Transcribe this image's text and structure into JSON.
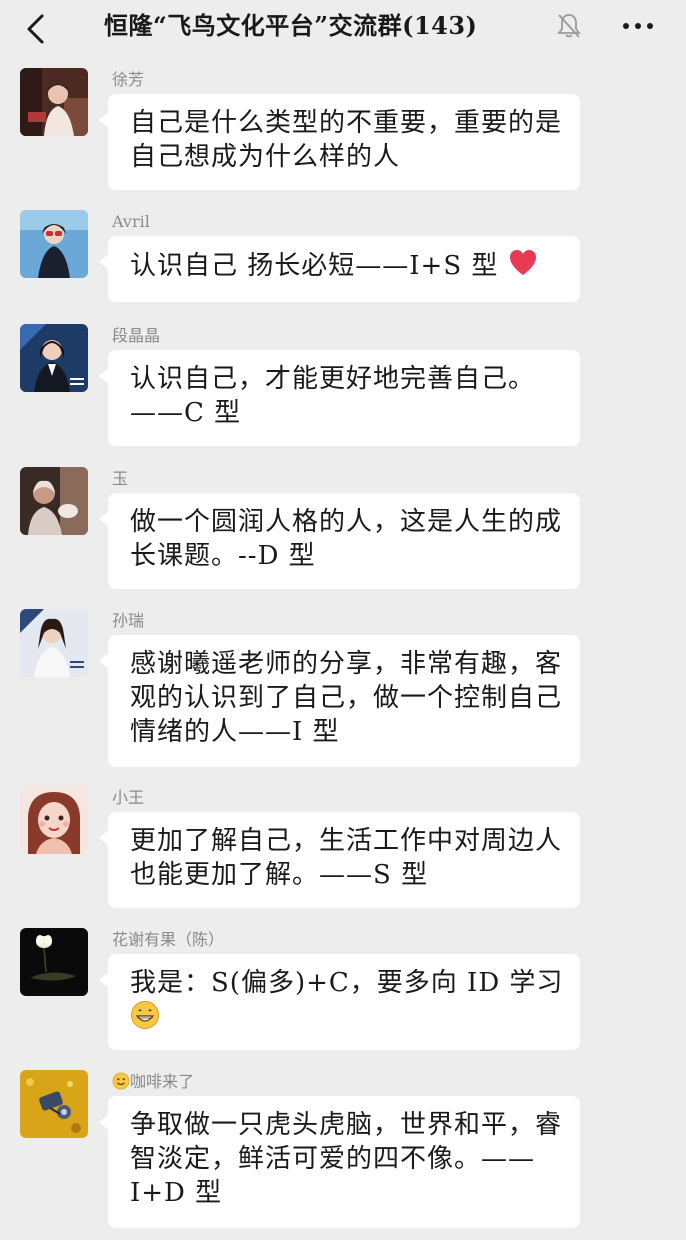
{
  "header": {
    "back_icon": "chevron-left-icon",
    "title": "恒隆“飞鸟文化平台”交流群(143)",
    "mute_icon": "bell-muted-icon",
    "more_icon": "ellipsis-icon"
  },
  "messages": [
    {
      "sender": "徐芳",
      "text": "自己是什么类型的不重要，重要的是自己想成为什么样的人"
    },
    {
      "sender": "Avril",
      "text": "认识自己 扬长必短——I+S 型",
      "emoji": "red-heart"
    },
    {
      "sender": "段晶晶",
      "text": "认识自己，才能更好地完善自己。——C 型"
    },
    {
      "sender": "玉",
      "text": "做一个圆润人格的人，这是人生的成长课题。--D 型"
    },
    {
      "sender": "孙瑞",
      "text": "感谢曦遥老师的分享，非常有趣，客观的认识到了自己，做一个控制自己情绪的人——I 型"
    },
    {
      "sender": "小王",
      "text": "更加了解自己，生活工作中对周边人也能更加了解。——S 型"
    },
    {
      "sender": "花谢有果（陈）",
      "text": "我是：S(偏多)+C，要多向 ID 学习",
      "emoji": "grinning-face"
    },
    {
      "sender": "咖啡来了",
      "sender_emoji": "smiling-face",
      "text": "争取做一只虎头虎脑，世界和平，睿智淡定，鲜活可爱的四不像。——I+D 型"
    }
  ],
  "colors": {
    "background": "#ededed",
    "bubble": "#ffffff",
    "sender": "#8a8a8a",
    "text": "#1a1a1a"
  }
}
